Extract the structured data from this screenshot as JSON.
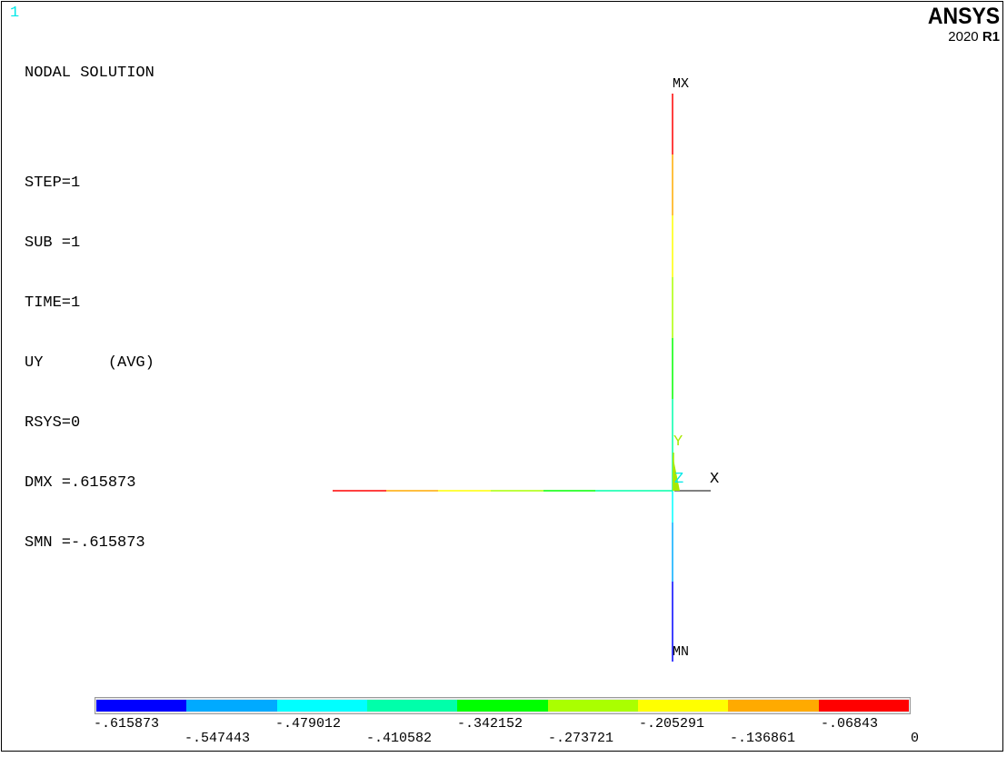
{
  "window": {
    "number": "1"
  },
  "info": {
    "title": "NODAL SOLUTION",
    "lines": [
      "STEP=1",
      "SUB =1",
      "TIME=1",
      "UY       (AVG)",
      "RSYS=0",
      "DMX =.615873",
      "SMN =-.615873"
    ]
  },
  "brand": {
    "name": "ANSYS",
    "version_year": "2020",
    "version_release": "R1"
  },
  "plot_labels": {
    "max": "MX",
    "min": "MN"
  },
  "triad": {
    "x": "X",
    "y": "Y",
    "z": "Z"
  },
  "colors": {
    "triad_y": "#a8e800",
    "triad_z": "#00e8e8",
    "window_number": "#00e8e8"
  },
  "legend": {
    "colors": [
      "#0000ff",
      "#00aaff",
      "#00ffff",
      "#00ffaa",
      "#00ff00",
      "#aaff00",
      "#ffff00",
      "#ffaa00",
      "#ff0000"
    ],
    "labels": [
      "-.615873",
      "-.547443",
      "-.479012",
      "-.410582",
      "-.342152",
      "-.273721",
      "-.205291",
      "-.136861",
      "-.06843",
      "0"
    ]
  }
}
